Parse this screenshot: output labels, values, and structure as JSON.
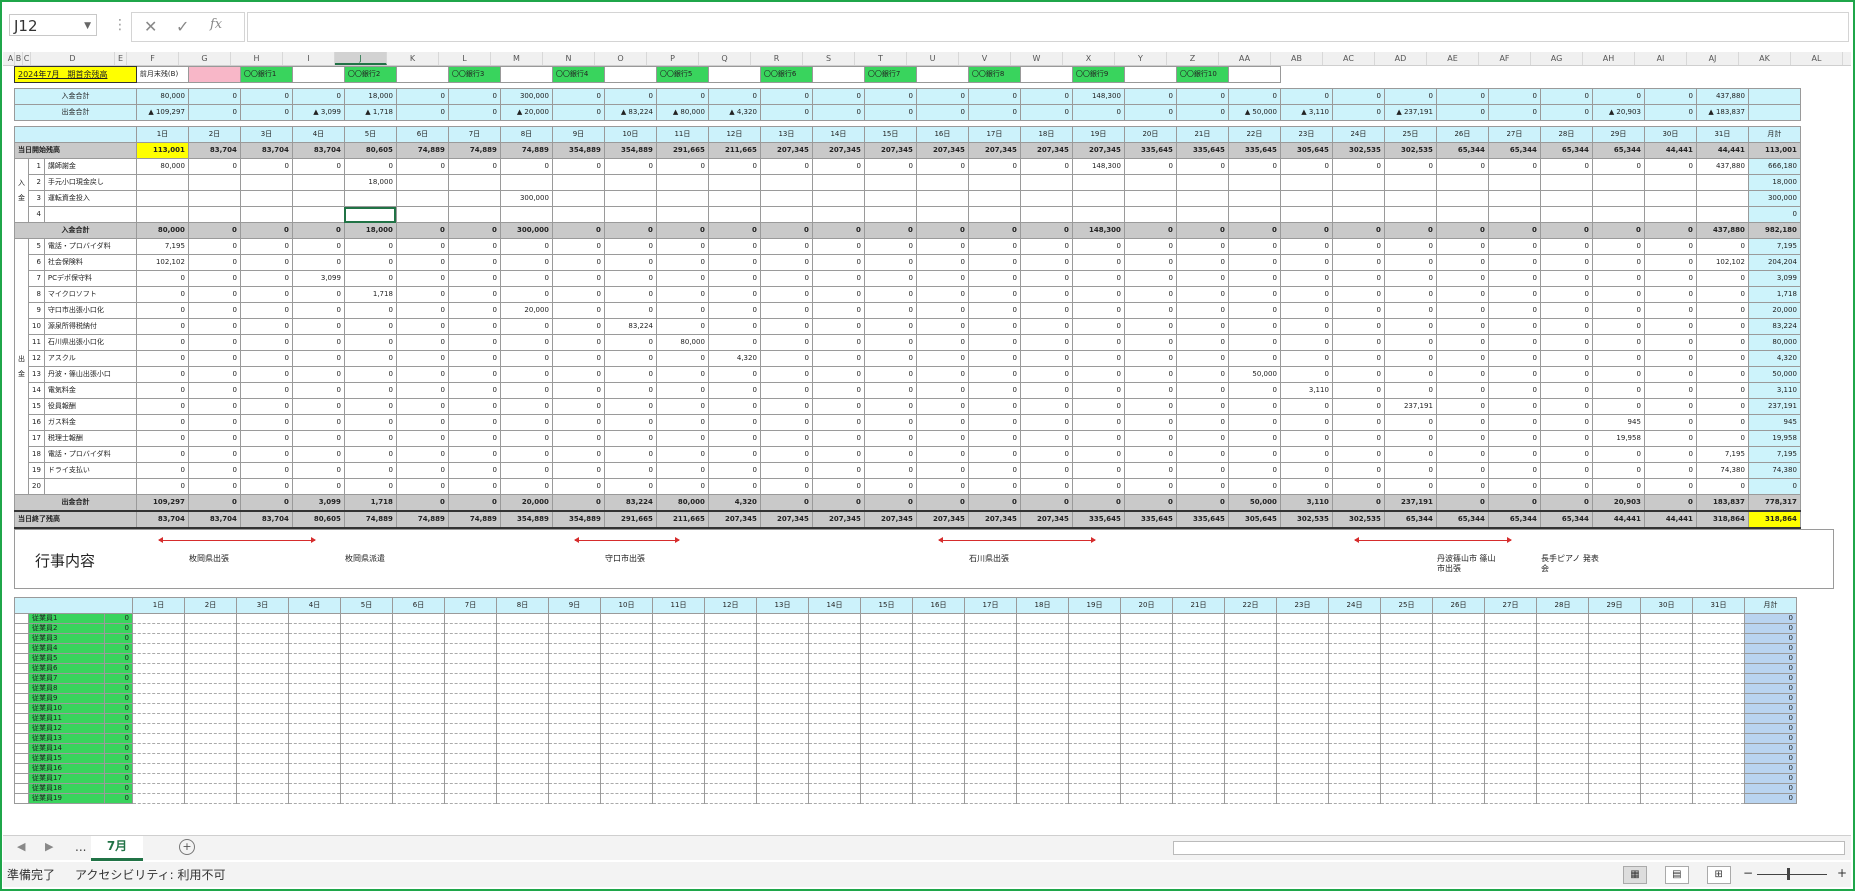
{
  "namebox": "J12",
  "fx": "fx",
  "columns": [
    "A",
    "B",
    "C",
    "D",
    "E",
    "F",
    "G",
    "H",
    "I",
    "J",
    "K",
    "L",
    "M",
    "N",
    "O",
    "P",
    "Q",
    "R",
    "S",
    "T",
    "U",
    "V",
    "W",
    "X",
    "Y",
    "Z",
    "AA",
    "AB",
    "AC",
    "AD",
    "AE",
    "AF",
    "AG",
    "AH",
    "AI",
    "AJ",
    "AK",
    "AL"
  ],
  "title": "2024年7月　期首余残高",
  "prev_month_label": "前月末残(B)",
  "banks": [
    "〇〇銀行1",
    "〇〇銀行2",
    "〇〇銀行3",
    "〇〇銀行4",
    "〇〇銀行5",
    "〇〇銀行6",
    "〇〇銀行7",
    "〇〇銀行8",
    "〇〇銀行9",
    "〇〇銀行10"
  ],
  "summary_in_label": "入金合計",
  "summary_out_label": "出金合計",
  "summary_in": [
    "80,000",
    "0",
    "0",
    "0",
    "18,000",
    "0",
    "0",
    "300,000",
    "0",
    "0",
    "0",
    "0",
    "0",
    "0",
    "0",
    "0",
    "0",
    "0",
    "148,300",
    "0",
    "0",
    "0",
    "0",
    "0",
    "0",
    "0",
    "0",
    "0",
    "0",
    "0",
    "437,880"
  ],
  "summary_out": [
    "▲ 109,297",
    "0",
    "0",
    "▲ 3,099",
    "▲ 1,718",
    "0",
    "0",
    "▲ 20,000",
    "0",
    "▲ 83,224",
    "▲ 80,000",
    "▲ 4,320",
    "0",
    "0",
    "0",
    "0",
    "0",
    "0",
    "0",
    "0",
    "0",
    "▲ 50,000",
    "▲ 3,110",
    "0",
    "▲ 237,191",
    "0",
    "0",
    "0",
    "▲ 20,903",
    "0",
    "▲ 183,837"
  ],
  "days": [
    "1日",
    "2日",
    "3日",
    "4日",
    "5日",
    "6日",
    "7日",
    "8日",
    "9日",
    "10日",
    "11日",
    "12日",
    "13日",
    "14日",
    "15日",
    "16日",
    "17日",
    "18日",
    "19日",
    "20日",
    "21日",
    "22日",
    "23日",
    "24日",
    "25日",
    "26日",
    "27日",
    "28日",
    "29日",
    "30日",
    "31日"
  ],
  "monthly": "月計",
  "opening_label": "当日開始残高",
  "opening": [
    "113,001",
    "83,704",
    "83,704",
    "83,704",
    "80,605",
    "74,889",
    "74,889",
    "74,889",
    "354,889",
    "354,889",
    "291,665",
    "211,665",
    "207,345",
    "207,345",
    "207,345",
    "207,345",
    "207,345",
    "207,345",
    "207,345",
    "335,645",
    "335,645",
    "335,645",
    "305,645",
    "302,535",
    "302,535",
    "65,344",
    "65,344",
    "65,344",
    "65,344",
    "44,441",
    "44,441"
  ],
  "opening_month": "113,001",
  "in_side": "入金",
  "in_rows": [
    {
      "no": "1",
      "label": "講師謝金",
      "vals": [
        "80,000",
        "0",
        "0",
        "0",
        "0",
        "0",
        "0",
        "0",
        "0",
        "0",
        "0",
        "0",
        "0",
        "0",
        "0",
        "0",
        "0",
        "0",
        "148,300",
        "0",
        "0",
        "0",
        "0",
        "0",
        "0",
        "0",
        "0",
        "0",
        "0",
        "0",
        "437,880"
      ],
      "month": "666,180"
    },
    {
      "no": "2",
      "label": "手元小口現金戻し",
      "vals": [
        "",
        "",
        "",
        "",
        "18,000",
        "",
        "",
        "",
        "",
        "",
        "",
        "",
        "",
        "",
        "",
        "",
        "",
        "",
        "",
        "",
        "",
        "",
        "",
        "",
        "",
        "",
        "",
        "",
        "",
        "",
        ""
      ],
      "month": "18,000"
    },
    {
      "no": "3",
      "label": "運転資金投入",
      "vals": [
        "",
        "",
        "",
        "",
        "",
        "",
        "",
        "300,000",
        "",
        "",
        "",
        "",
        "",
        "",
        "",
        "",
        "",
        "",
        "",
        "",
        "",
        "",
        "",
        "",
        "",
        "",
        "",
        "",
        "",
        "",
        ""
      ],
      "month": "300,000"
    },
    {
      "no": "4",
      "label": "",
      "vals": [
        "",
        "",
        "",
        "",
        "",
        "",
        "",
        "",
        "",
        "",
        "",
        "",
        "",
        "",
        "",
        "",
        "",
        "",
        "",
        "",
        "",
        "",
        "",
        "",
        "",
        "",
        "",
        "",
        "",
        "",
        ""
      ],
      "month": "0"
    }
  ],
  "in_total_label": "入金合計",
  "in_total": [
    "80,000",
    "0",
    "0",
    "0",
    "18,000",
    "0",
    "0",
    "300,000",
    "0",
    "0",
    "0",
    "0",
    "0",
    "0",
    "0",
    "0",
    "0",
    "0",
    "148,300",
    "0",
    "0",
    "0",
    "0",
    "0",
    "0",
    "0",
    "0",
    "0",
    "0",
    "0",
    "437,880"
  ],
  "in_total_month": "982,180",
  "out_side": "出金",
  "out_rows": [
    {
      "no": "5",
      "label": "電話・プロバイダ料",
      "vals": [
        "7,195",
        "0",
        "0",
        "0",
        "0",
        "0",
        "0",
        "0",
        "0",
        "0",
        "0",
        "0",
        "0",
        "0",
        "0",
        "0",
        "0",
        "0",
        "0",
        "0",
        "0",
        "0",
        "0",
        "0",
        "0",
        "0",
        "0",
        "0",
        "0",
        "0",
        "0"
      ],
      "month": "7,195"
    },
    {
      "no": "6",
      "label": "社会保険料",
      "vals": [
        "102,102",
        "0",
        "0",
        "0",
        "0",
        "0",
        "0",
        "0",
        "0",
        "0",
        "0",
        "0",
        "0",
        "0",
        "0",
        "0",
        "0",
        "0",
        "0",
        "0",
        "0",
        "0",
        "0",
        "0",
        "0",
        "0",
        "0",
        "0",
        "0",
        "0",
        "102,102"
      ],
      "month": "204,204"
    },
    {
      "no": "7",
      "label": "PCデポ保守料",
      "vals": [
        "0",
        "0",
        "0",
        "3,099",
        "0",
        "0",
        "0",
        "0",
        "0",
        "0",
        "0",
        "0",
        "0",
        "0",
        "0",
        "0",
        "0",
        "0",
        "0",
        "0",
        "0",
        "0",
        "0",
        "0",
        "0",
        "0",
        "0",
        "0",
        "0",
        "0",
        "0"
      ],
      "month": "3,099"
    },
    {
      "no": "8",
      "label": "マイクロソフト",
      "vals": [
        "0",
        "0",
        "0",
        "0",
        "1,718",
        "0",
        "0",
        "0",
        "0",
        "0",
        "0",
        "0",
        "0",
        "0",
        "0",
        "0",
        "0",
        "0",
        "0",
        "0",
        "0",
        "0",
        "0",
        "0",
        "0",
        "0",
        "0",
        "0",
        "0",
        "0",
        "0"
      ],
      "month": "1,718"
    },
    {
      "no": "9",
      "label": "守口市出張小口化",
      "vals": [
        "0",
        "0",
        "0",
        "0",
        "0",
        "0",
        "0",
        "20,000",
        "0",
        "0",
        "0",
        "0",
        "0",
        "0",
        "0",
        "0",
        "0",
        "0",
        "0",
        "0",
        "0",
        "0",
        "0",
        "0",
        "0",
        "0",
        "0",
        "0",
        "0",
        "0",
        "0"
      ],
      "month": "20,000"
    },
    {
      "no": "10",
      "label": "源泉所得税納付",
      "vals": [
        "0",
        "0",
        "0",
        "0",
        "0",
        "0",
        "0",
        "0",
        "0",
        "83,224",
        "0",
        "0",
        "0",
        "0",
        "0",
        "0",
        "0",
        "0",
        "0",
        "0",
        "0",
        "0",
        "0",
        "0",
        "0",
        "0",
        "0",
        "0",
        "0",
        "0",
        "0"
      ],
      "month": "83,224"
    },
    {
      "no": "11",
      "label": "石川県出張小口化",
      "vals": [
        "0",
        "0",
        "0",
        "0",
        "0",
        "0",
        "0",
        "0",
        "0",
        "0",
        "80,000",
        "0",
        "0",
        "0",
        "0",
        "0",
        "0",
        "0",
        "0",
        "0",
        "0",
        "0",
        "0",
        "0",
        "0",
        "0",
        "0",
        "0",
        "0",
        "0",
        "0"
      ],
      "month": "80,000"
    },
    {
      "no": "12",
      "label": "アスクル",
      "vals": [
        "0",
        "0",
        "0",
        "0",
        "0",
        "0",
        "0",
        "0",
        "0",
        "0",
        "0",
        "4,320",
        "0",
        "0",
        "0",
        "0",
        "0",
        "0",
        "0",
        "0",
        "0",
        "0",
        "0",
        "0",
        "0",
        "0",
        "0",
        "0",
        "0",
        "0",
        "0"
      ],
      "month": "4,320"
    },
    {
      "no": "13",
      "label": "丹波・篠山出張小口",
      "vals": [
        "0",
        "0",
        "0",
        "0",
        "0",
        "0",
        "0",
        "0",
        "0",
        "0",
        "0",
        "0",
        "0",
        "0",
        "0",
        "0",
        "0",
        "0",
        "0",
        "0",
        "0",
        "50,000",
        "0",
        "0",
        "0",
        "0",
        "0",
        "0",
        "0",
        "0",
        "0"
      ],
      "month": "50,000"
    },
    {
      "no": "14",
      "label": "電気料金",
      "vals": [
        "0",
        "0",
        "0",
        "0",
        "0",
        "0",
        "0",
        "0",
        "0",
        "0",
        "0",
        "0",
        "0",
        "0",
        "0",
        "0",
        "0",
        "0",
        "0",
        "0",
        "0",
        "0",
        "3,110",
        "0",
        "0",
        "0",
        "0",
        "0",
        "0",
        "0",
        "0"
      ],
      "month": "3,110"
    },
    {
      "no": "15",
      "label": "役員報酬",
      "vals": [
        "0",
        "0",
        "0",
        "0",
        "0",
        "0",
        "0",
        "0",
        "0",
        "0",
        "0",
        "0",
        "0",
        "0",
        "0",
        "0",
        "0",
        "0",
        "0",
        "0",
        "0",
        "0",
        "0",
        "0",
        "237,191",
        "0",
        "0",
        "0",
        "0",
        "0",
        "0"
      ],
      "month": "237,191"
    },
    {
      "no": "16",
      "label": "ガス料金",
      "vals": [
        "0",
        "0",
        "0",
        "0",
        "0",
        "0",
        "0",
        "0",
        "0",
        "0",
        "0",
        "0",
        "0",
        "0",
        "0",
        "0",
        "0",
        "0",
        "0",
        "0",
        "0",
        "0",
        "0",
        "0",
        "0",
        "0",
        "0",
        "0",
        "945",
        "0",
        "0"
      ],
      "month": "945"
    },
    {
      "no": "17",
      "label": "税理士報酬",
      "vals": [
        "0",
        "0",
        "0",
        "0",
        "0",
        "0",
        "0",
        "0",
        "0",
        "0",
        "0",
        "0",
        "0",
        "0",
        "0",
        "0",
        "0",
        "0",
        "0",
        "0",
        "0",
        "0",
        "0",
        "0",
        "0",
        "0",
        "0",
        "0",
        "19,958",
        "0",
        "0"
      ],
      "month": "19,958"
    },
    {
      "no": "18",
      "label": "電話・プロバイダ料",
      "vals": [
        "0",
        "0",
        "0",
        "0",
        "0",
        "0",
        "0",
        "0",
        "0",
        "0",
        "0",
        "0",
        "0",
        "0",
        "0",
        "0",
        "0",
        "0",
        "0",
        "0",
        "0",
        "0",
        "0",
        "0",
        "0",
        "0",
        "0",
        "0",
        "0",
        "0",
        "7,195"
      ],
      "month": "7,195"
    },
    {
      "no": "19",
      "label": "ドライ支払い",
      "vals": [
        "0",
        "0",
        "0",
        "0",
        "0",
        "0",
        "0",
        "0",
        "0",
        "0",
        "0",
        "0",
        "0",
        "0",
        "0",
        "0",
        "0",
        "0",
        "0",
        "0",
        "0",
        "0",
        "0",
        "0",
        "0",
        "0",
        "0",
        "0",
        "0",
        "0",
        "74,380"
      ],
      "month": "74,380"
    },
    {
      "no": "20",
      "label": "",
      "vals": [
        "0",
        "0",
        "0",
        "0",
        "0",
        "0",
        "0",
        "0",
        "0",
        "0",
        "0",
        "0",
        "0",
        "0",
        "0",
        "0",
        "0",
        "0",
        "0",
        "0",
        "0",
        "0",
        "0",
        "0",
        "0",
        "0",
        "0",
        "0",
        "0",
        "0",
        "0"
      ],
      "month": "0"
    }
  ],
  "out_total_label": "出金合計",
  "out_total": [
    "109,297",
    "0",
    "0",
    "3,099",
    "1,718",
    "0",
    "0",
    "20,000",
    "0",
    "83,224",
    "80,000",
    "4,320",
    "0",
    "0",
    "0",
    "0",
    "0",
    "0",
    "0",
    "0",
    "0",
    "50,000",
    "3,110",
    "0",
    "237,191",
    "0",
    "0",
    "0",
    "20,903",
    "0",
    "183,837"
  ],
  "out_total_month": "778,317",
  "closing_label": "当日終了残高",
  "closing": [
    "83,704",
    "83,704",
    "83,704",
    "80,605",
    "74,889",
    "74,889",
    "74,889",
    "354,889",
    "354,889",
    "291,665",
    "211,665",
    "207,345",
    "207,345",
    "207,345",
    "207,345",
    "207,345",
    "207,345",
    "207,345",
    "335,645",
    "335,645",
    "335,645",
    "305,645",
    "302,535",
    "302,535",
    "65,344",
    "65,344",
    "65,344",
    "65,344",
    "44,441",
    "44,441",
    "318,864"
  ],
  "closing_month": "318,864",
  "events_label": "行事内容",
  "events": [
    {
      "text": "枚岡県出張"
    },
    {
      "text": "枚岡県派遣"
    },
    {
      "text": "守口市出張"
    },
    {
      "text": "石川県出張"
    },
    {
      "text": "丹波篠山市 篠山市出張"
    },
    {
      "text": "長手ピアノ 発表会"
    }
  ],
  "staff": [
    "従業員1",
    "従業員2",
    "従業員3",
    "従業員4",
    "従業員5",
    "従業員6",
    "従業員7",
    "従業員8",
    "従業員9",
    "従業員10",
    "従業員11",
    "従業員12",
    "従業員13",
    "従業員14",
    "従業員15",
    "従業員16",
    "従業員17",
    "従業員18",
    "従業員19"
  ],
  "staff_zero": "0",
  "sheet_tab": "7月",
  "more_tabs": "...",
  "status_ready": "準備完了",
  "status_access": "アクセシビリティ: 利用不可"
}
